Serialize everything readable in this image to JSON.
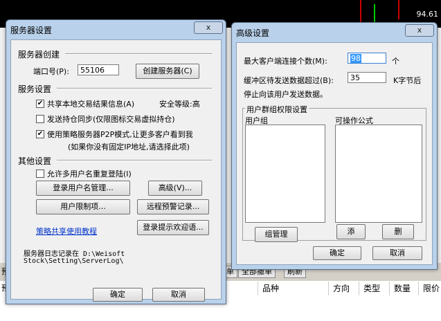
{
  "background": {
    "price_label": "94.61",
    "buttons": [
      "单",
      "全部撤单",
      "刷新"
    ],
    "columns": [
      "品种",
      "方向",
      "类型",
      "数量",
      "限价"
    ],
    "left_fragments": [
      "预",
      "预"
    ]
  },
  "server_dialog": {
    "title": "服务器设置",
    "close_symbol": "x",
    "section_create": "服务器创建",
    "port_label": "端口号(P):",
    "port_value": "55106",
    "create_button": "创建服务器(C)",
    "section_service": "服务设置",
    "share_label": "共享本地交易结果信息(A)",
    "security_label": "安全等级:高",
    "sync_label": "发送持仓同步(仅限图标交易虚拟持仓)",
    "p2p_label": "使用策略服务器P2P模式,让更多客户看到我",
    "p2p_note": "(如果你没有固定IP地址,请选择此项)",
    "section_other": "其他设置",
    "allow_dup_label": "允许多用户名重复登陆(I)",
    "login_user_button": "登录用户名管理...",
    "advanced_button": "高级(V)...",
    "user_limit_button": "用户限制项...",
    "remote_alert_button": "远程预警记录...",
    "login_tip_button": "登录提示欢迎语...",
    "share_tutorial_link": "策略共享使用教程",
    "log_text_1": "服务器日志记录在 D:\\Weisoft",
    "log_text_2": "Stock\\Setting\\ServerLog\\",
    "ok_button": "确定",
    "cancel_button": "取消",
    "share_checked": true,
    "sync_checked": false,
    "p2p_checked": true,
    "allow_dup_checked": false
  },
  "advanced_dialog": {
    "title": "高级设置",
    "close_symbol": "x",
    "max_conn_label": "最大客户端连接个数(M):",
    "max_conn_value": "98",
    "max_conn_unit": "个",
    "buffer_label": "缓冲区待发送数据超过(B):",
    "buffer_value": "35",
    "buffer_unit": "K字节后",
    "stop_text": "停止向该用户发送数据。",
    "group_title": "用户群组权限设置",
    "user_group_label": "用户组",
    "formula_label": "可操作公式",
    "group_manage_button": "组管理",
    "add_button": "添",
    "delete_button": "删",
    "ok_button": "确定",
    "cancel_button": "取消"
  }
}
